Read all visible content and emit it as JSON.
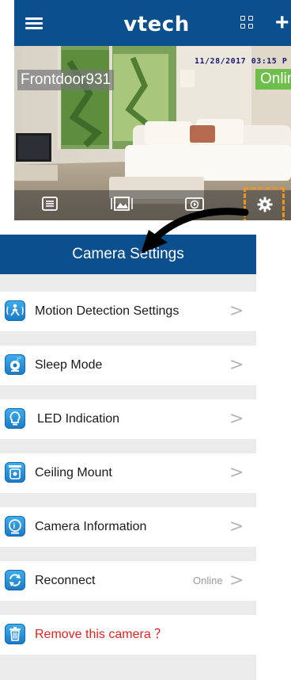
{
  "top_screen": {
    "brand": "vtech",
    "camera_name": "Frontdoor931",
    "timestamp": "11/28/2017 03:15 P",
    "status_badge": "Onlin",
    "icons": [
      "menu-icon",
      "grid-icon",
      "plus-icon",
      "list-icon",
      "gallery-icon",
      "playback-icon",
      "gear-icon"
    ],
    "colors": {
      "header": "#0b4f8f",
      "badge": "#6cc04a",
      "highlight": "#f0921e"
    }
  },
  "settings": {
    "title": "Camera Settings",
    "items": [
      {
        "label": "Motion Detection Settings",
        "icon": "motion-icon",
        "chevron": ">"
      },
      {
        "label": "Sleep Mode",
        "icon": "sleep-icon",
        "chevron": ">"
      },
      {
        "label": "LED Indication",
        "icon": "bulb-icon",
        "chevron": ">"
      },
      {
        "label": "Ceiling Mount",
        "icon": "ceiling-mount-icon",
        "chevron": ">"
      },
      {
        "label": "Camera Information",
        "icon": "info-icon",
        "chevron": ">"
      },
      {
        "label": "Reconnect",
        "icon": "reconnect-icon",
        "status": "Online",
        "chevron": ">"
      },
      {
        "label": "Remove this camera ？",
        "icon": "trash-icon",
        "color": "#e02222"
      }
    ]
  }
}
